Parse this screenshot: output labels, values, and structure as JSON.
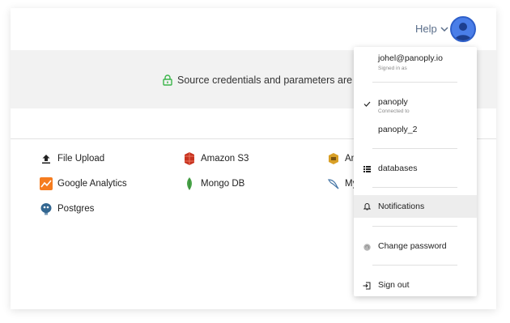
{
  "header": {
    "help_label": "Help"
  },
  "banner": {
    "text": "Source credentials and parameters are encr"
  },
  "sources": [
    {
      "label": "File Upload",
      "icon": "upload-icon"
    },
    {
      "label": "Amazon S3",
      "icon": "amazon-s3-icon"
    },
    {
      "label": "Am",
      "icon": "amazon-icon"
    },
    {
      "label": "Google Analytics",
      "icon": "google-analytics-icon"
    },
    {
      "label": "Mongo DB",
      "icon": "mongodb-icon"
    },
    {
      "label": "My",
      "icon": "mysql-icon"
    },
    {
      "label": "Postgres",
      "icon": "postgres-icon"
    }
  ],
  "dropdown": {
    "email": "johel@panoply.io",
    "signed_in_label": "Signed in as",
    "workspaces": [
      {
        "name": "panoply",
        "status": "Connected to",
        "selected": true
      },
      {
        "name": "panoply_2"
      }
    ],
    "databases_label": "databases",
    "notifications_label": "Notifications",
    "change_password_label": "Change password",
    "sign_out_label": "Sign out"
  },
  "colors": {
    "accent_green": "#3bb54a",
    "avatar_blue": "#4a7ee8",
    "help_text": "#5a6e8a"
  }
}
